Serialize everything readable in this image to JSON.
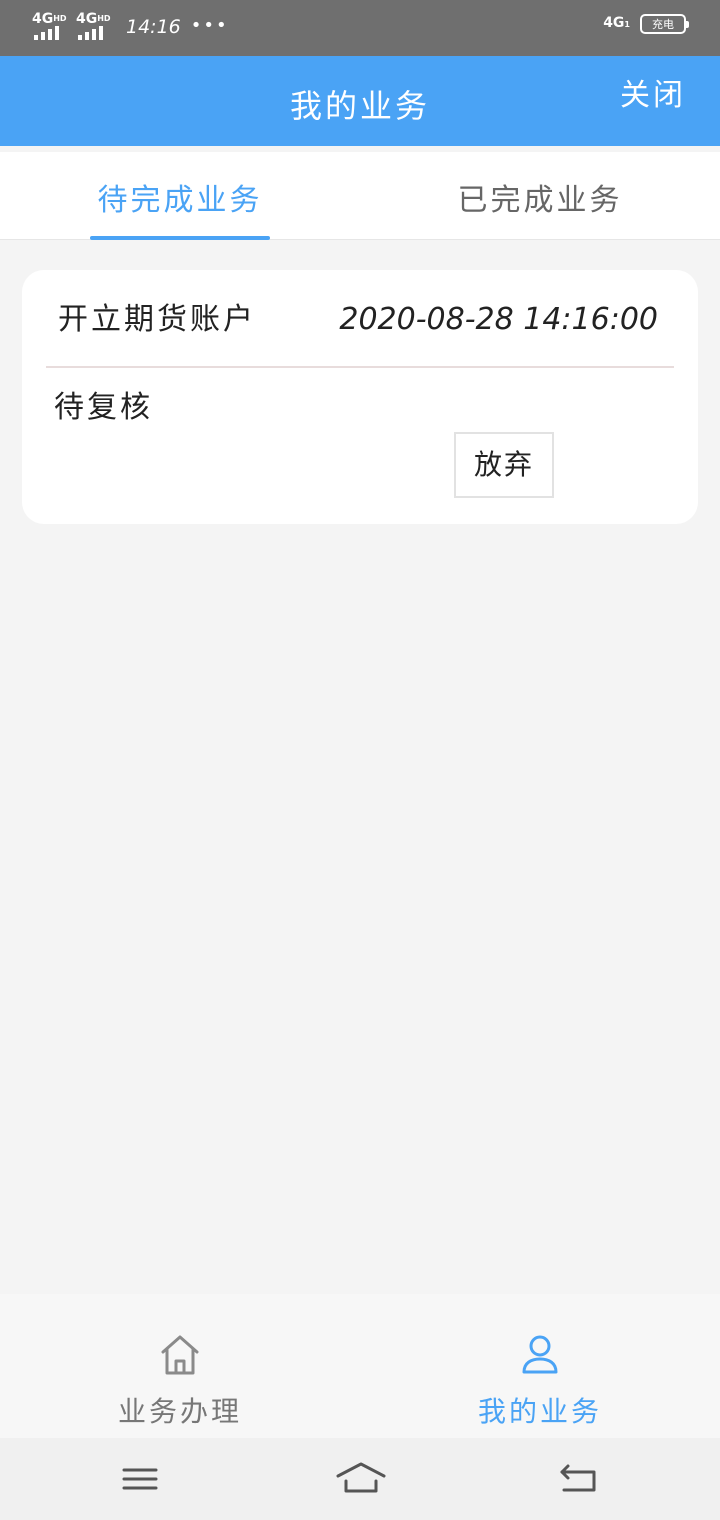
{
  "status_bar": {
    "signal_1": "4G",
    "signal_1_sup": "HD",
    "signal_2": "4G",
    "signal_2_sup": "HD",
    "time": "14:16",
    "dots": "•••",
    "network": "4G",
    "network_sub": "1",
    "battery_label": "充电"
  },
  "header": {
    "title": "我的业务",
    "close_label": "关闭"
  },
  "tabs": [
    {
      "label": "待完成业务",
      "active": true
    },
    {
      "label": "已完成业务",
      "active": false
    }
  ],
  "task_card": {
    "name": "开立期货账户",
    "time": "2020-08-28 14:16:00",
    "status": "待复核",
    "abandon_label": "放弃"
  },
  "bottom_nav": {
    "items": [
      {
        "label": "业务办理",
        "icon": "home-icon",
        "active": false
      },
      {
        "label": "我的业务",
        "icon": "user-icon",
        "active": true
      }
    ]
  },
  "system_nav": {
    "icons": [
      "menu-icon",
      "home-icon",
      "back-icon"
    ]
  },
  "colors": {
    "accent": "#4aa3f5",
    "status_bar": "#6f6f6f",
    "background": "#f4f4f4"
  }
}
